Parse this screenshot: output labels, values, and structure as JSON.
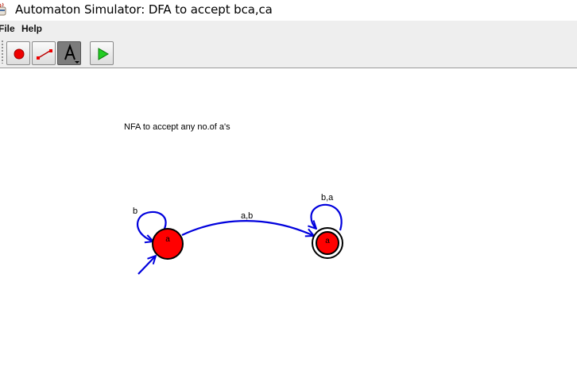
{
  "window": {
    "title": "Automaton Simulator: DFA to accept bca,ca"
  },
  "menu": {
    "items": [
      {
        "label": "File"
      },
      {
        "label": "Help"
      }
    ]
  },
  "toolbar": {
    "tools": [
      {
        "name": "state-tool",
        "icon": "red-circle-icon"
      },
      {
        "name": "transition-tool",
        "icon": "transition-line-icon"
      },
      {
        "name": "text-tool",
        "icon": "text-a-icon",
        "selected": true
      },
      {
        "name": "run-tool",
        "icon": "green-play-icon"
      }
    ]
  },
  "canvas": {
    "note": "NFA to accept any no.of a's",
    "states": [
      {
        "label": "a",
        "initial": true,
        "final": false
      },
      {
        "label": "a",
        "initial": false,
        "final": true
      }
    ],
    "transitions": [
      {
        "label": "b",
        "type": "self-loop"
      },
      {
        "label": "a,b",
        "type": "edge"
      },
      {
        "label": "b,a",
        "type": "self-loop"
      }
    ],
    "colors": {
      "state_fill": "#ff0000",
      "edge": "#0000dd"
    }
  }
}
